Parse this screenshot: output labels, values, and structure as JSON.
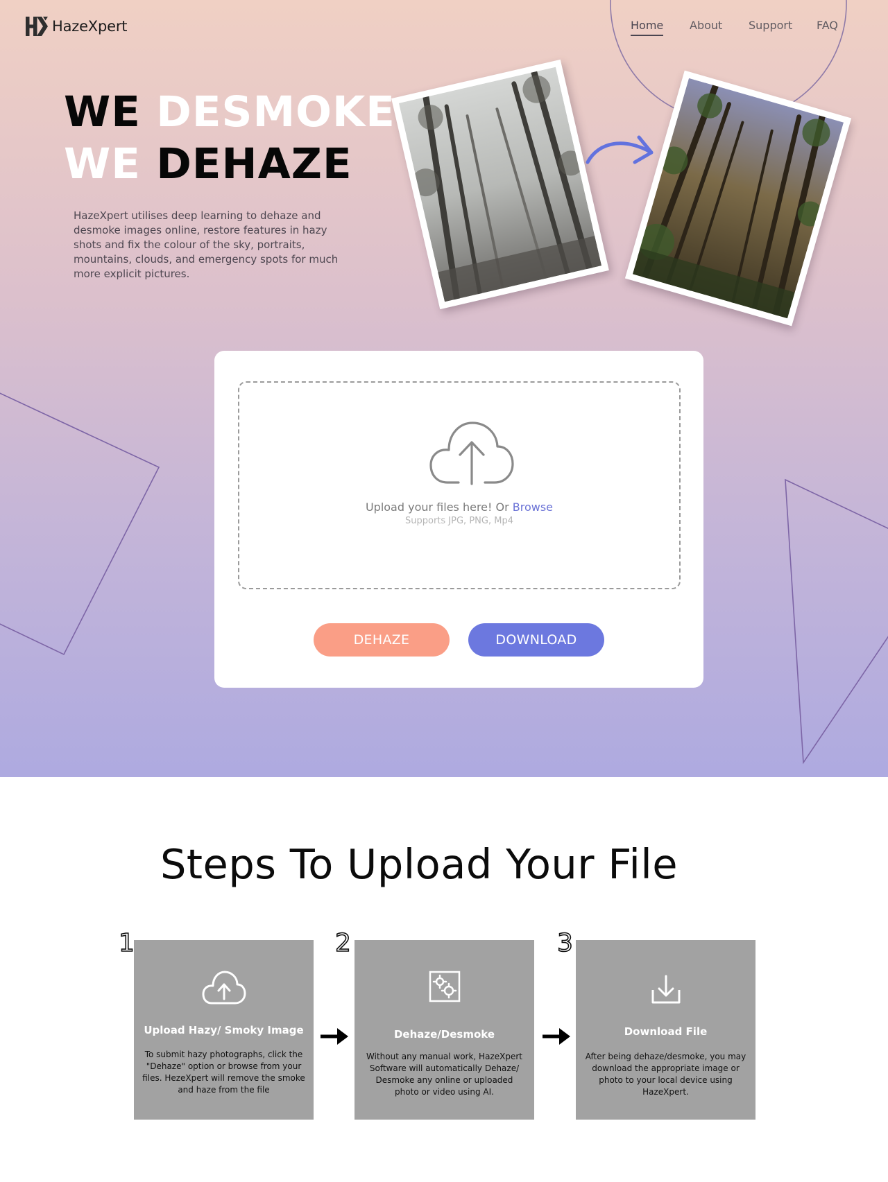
{
  "brand": {
    "name": "HazeXpert",
    "logo_icon": "hx-logo-icon"
  },
  "nav": {
    "items": [
      {
        "label": "Home",
        "active": true
      },
      {
        "label": "About",
        "active": false
      },
      {
        "label": "Support",
        "active": false
      },
      {
        "label": "FAQ",
        "active": false
      }
    ]
  },
  "hero": {
    "line1_we": "WE",
    "line1_word": "DESMOKE",
    "line2_we": "WE",
    "line2_word": "DEHAZE",
    "description": "HazeXpert utilises deep learning to dehaze and desmoke images online, restore features in hazy shots and fix the colour of the sky, portraits, mountains, clouds, and emergency spots for much more explicit pictures.",
    "before_photo_icon": "hazy-forest-photo",
    "after_photo_icon": "clear-forest-photo",
    "arrow_icon": "curved-arrow-icon"
  },
  "upload": {
    "icon": "cloud-upload-icon",
    "prompt": "Upload your files here! Or ",
    "browse_label": "Browse",
    "supports": "Supports JPG, PNG, Mp4",
    "dehaze_label": "DEHAZE",
    "download_label": "DOWNLOAD"
  },
  "steps": {
    "title": "Steps To Upload Your File",
    "items": [
      {
        "number": "1",
        "icon": "cloud-upload-icon",
        "title": "Upload Hazy/ Smoky Image",
        "description": "To submit hazy photographs, click the \"Dehaze\" option or browse from your files. HezeXpert will remove the smoke and haze from the file"
      },
      {
        "number": "2",
        "icon": "gears-icon",
        "title": "Dehaze/Desmoke",
        "description": "Without any manual work, HazeXpert Software will automatically Dehaze/ Desmoke any online or uploaded photo or video using AI."
      },
      {
        "number": "3",
        "icon": "download-icon",
        "title": "Download File",
        "description": "After being dehaze/desmoke, you may download the appropriate image or photo to your local device using HazeXpert."
      }
    ]
  },
  "colors": {
    "accent_orange": "#fa9e86",
    "accent_blue": "#6c78df",
    "step_card": "#a2a2a2"
  }
}
